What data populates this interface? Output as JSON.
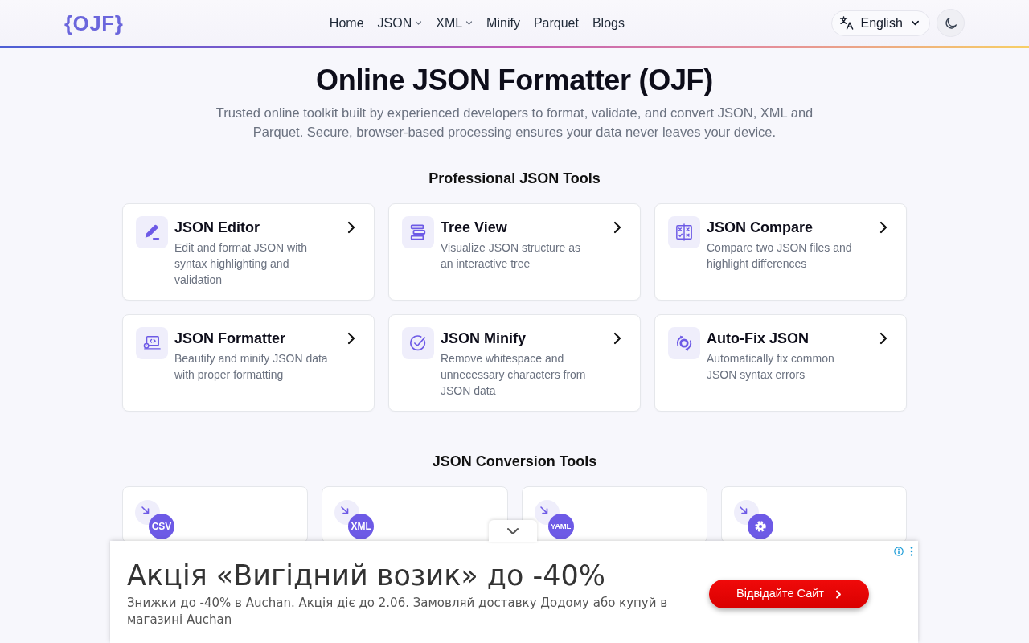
{
  "header": {
    "logo": "{OJF}",
    "nav": [
      {
        "label": "Home",
        "dropdown": false
      },
      {
        "label": "JSON",
        "dropdown": true
      },
      {
        "label": "XML",
        "dropdown": true
      },
      {
        "label": "Minify",
        "dropdown": false
      },
      {
        "label": "Parquet",
        "dropdown": false
      },
      {
        "label": "Blogs",
        "dropdown": false
      }
    ],
    "language": "English"
  },
  "hero": {
    "title": "Online JSON Formatter (OJF)",
    "subtitle": "Trusted online toolkit built by experienced developers to format, validate, and convert JSON, XML and Parquet. Secure, browser-based processing ensures your data never leaves your device."
  },
  "professional_tools": {
    "heading": "Professional JSON Tools",
    "items": [
      {
        "kind": "editor",
        "title": "JSON Editor",
        "description": "Edit and format JSON with syntax highlighting and validation"
      },
      {
        "kind": "tree",
        "title": "Tree View",
        "description": "Visualize JSON structure as an interactive tree"
      },
      {
        "kind": "compare",
        "title": "JSON Compare",
        "description": "Compare two JSON files and highlight differences"
      },
      {
        "kind": "formatter",
        "title": "JSON Formatter",
        "description": "Beautify and minify JSON data with proper formatting"
      },
      {
        "kind": "minify",
        "title": "JSON Minify",
        "description": "Remove whitespace and unnecessary characters from JSON data"
      },
      {
        "kind": "autofix",
        "title": "Auto-Fix JSON",
        "description": "Automatically fix common JSON syntax errors"
      }
    ]
  },
  "conversion_tools": {
    "heading": "JSON Conversion Tools",
    "items": [
      {
        "kind": "label",
        "badge": "CSV"
      },
      {
        "kind": "label",
        "badge": "XML"
      },
      {
        "kind": "label",
        "badge": "YAML"
      },
      {
        "kind": "gear"
      }
    ]
  },
  "ad": {
    "headline": "Акція «Вигідний возик» до -40%",
    "description": "Знижки до -40% в Auchan. Акція діє до 2.06. Замовляй доставку Додому або купуй в магазині Auchan",
    "button": "Відвідайте Сайт"
  }
}
